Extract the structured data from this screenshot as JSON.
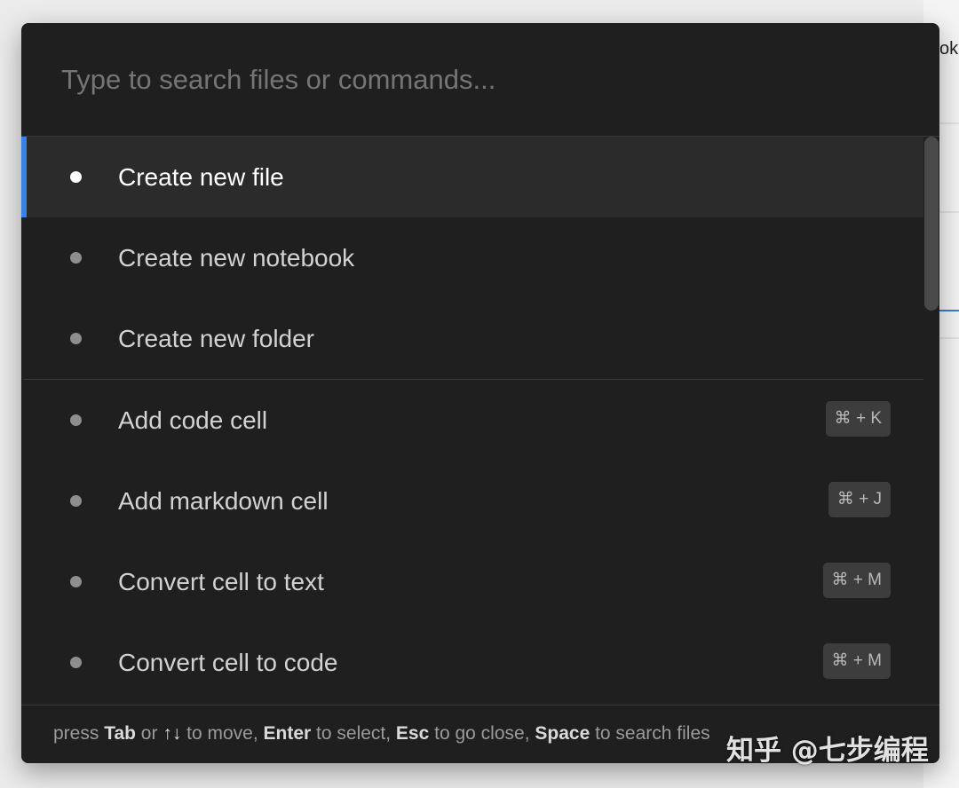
{
  "background_app": {
    "tab_fragment": "ok"
  },
  "search": {
    "placeholder": "Type to search files or commands...",
    "value": ""
  },
  "commands": [
    {
      "label": "Create new file",
      "active": true,
      "shortcut": ""
    },
    {
      "label": "Create new notebook",
      "active": false,
      "shortcut": ""
    },
    {
      "label": "Create new folder",
      "active": false,
      "shortcut": ""
    },
    {
      "label": "Add code cell",
      "active": false,
      "shortcut": "⌘ + K"
    },
    {
      "label": "Add markdown cell",
      "active": false,
      "shortcut": "⌘ + J"
    },
    {
      "label": "Convert cell to text",
      "active": false,
      "shortcut": "⌘ + M"
    },
    {
      "label": "Convert cell to code",
      "active": false,
      "shortcut": "⌘ + M"
    }
  ],
  "footer": {
    "t1": "press ",
    "k1": "Tab",
    "t2": " or ",
    "k2": "↑↓",
    "t3": " to move, ",
    "k3": "Enter",
    "t4": " to select, ",
    "k4": "Esc",
    "t5": " to go close, ",
    "k5": "Space",
    "t6": " to search files"
  },
  "watermark": {
    "text": "知乎 @七步编程"
  },
  "colors": {
    "panel": "#1f1f1f",
    "active_row": "#2b2b2b",
    "accent": "#3b82e6",
    "shortcut_bg": "#3d3d3d"
  },
  "icons": {
    "bullet": "bullet-dot-icon"
  }
}
